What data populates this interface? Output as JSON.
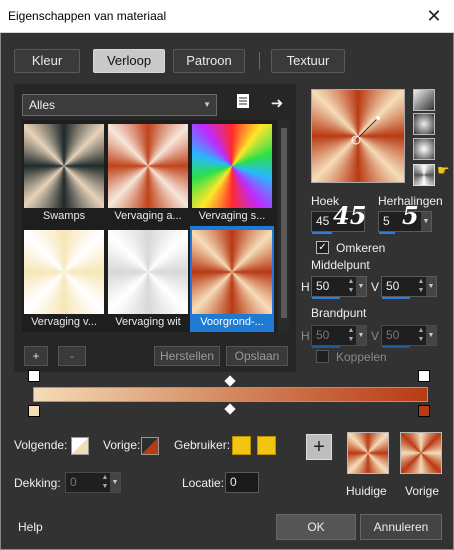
{
  "window": {
    "title": "Eigenschappen van materiaal",
    "close_glyph": "✕"
  },
  "tabs": [
    "Kleur",
    "Verloop",
    "Patroon",
    "Textuur"
  ],
  "gallery": {
    "dropdown_value": "Alles",
    "items": [
      {
        "label": "Swamps"
      },
      {
        "label": "Vervaging a..."
      },
      {
        "label": "Vervaging s..."
      },
      {
        "label": "Vervaging v..."
      },
      {
        "label": "Vervaging wit"
      },
      {
        "label": "Voorgrond-..."
      }
    ],
    "selected_index": 5
  },
  "gallery_buttons": {
    "add": "+",
    "remove": "-",
    "reset": "Herstellen",
    "save": "Opslaan"
  },
  "params": {
    "hoek_label": "Hoek",
    "hoek_value": "45",
    "hoek_big": "45",
    "herhalingen_label": "Herhalingen",
    "herhalingen_value": "5",
    "herhalingen_big": "5",
    "omkeren_label": "Omkeren",
    "omkeren_checked": true,
    "middelpunt_label": "Middelpunt",
    "middel_h_label": "H",
    "middel_h_value": "50",
    "middel_v_label": "V",
    "middel_v_value": "50",
    "brandpunt_label": "Brandpunt",
    "brand_h_label": "H",
    "brand_h_value": "50",
    "brand_v_label": "V",
    "brand_v_value": "50",
    "koppelen_label": "Koppelen"
  },
  "stops": {
    "volgende_label": "Volgende:",
    "vorige_label": "Vorige:",
    "gebruiker_label": "Gebruiker:",
    "gebruiker_color": "#f2c513",
    "dekking_label": "Dekking:",
    "dekking_value": "0",
    "locatie_label": "Locatie:",
    "locatie_value": "0"
  },
  "results": {
    "huidige_label": "Huidige",
    "vorige_label": "Vorige",
    "add_glyph": "+"
  },
  "footer": {
    "help": "Help",
    "ok": "OK",
    "cancel": "Annuleren"
  },
  "colors": {
    "accent": "#1e7bd3",
    "gradient_start": "#f5dcb8",
    "gradient_end": "#b83a14"
  }
}
